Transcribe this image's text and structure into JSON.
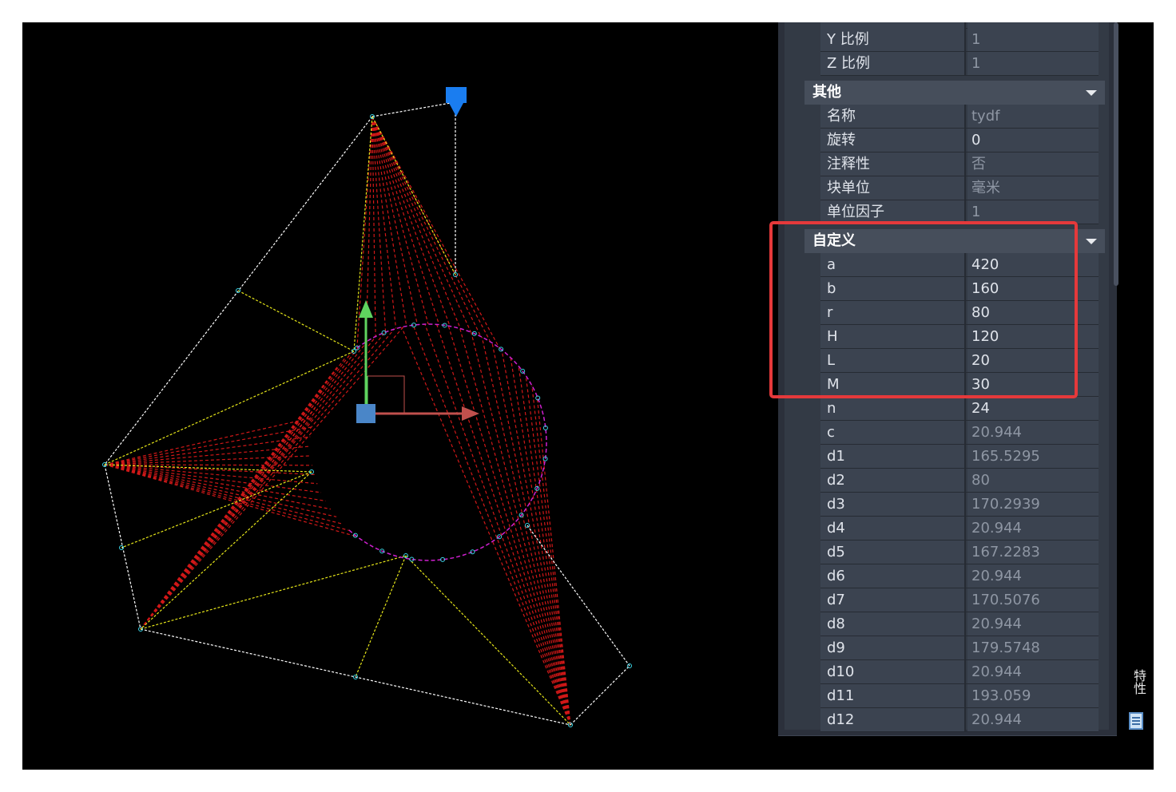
{
  "properties_panel": {
    "top_rows": [
      {
        "key": "Y 比例",
        "value": "1",
        "readonly": true
      },
      {
        "key": "Z 比例",
        "value": "1",
        "readonly": true
      }
    ],
    "section_other": {
      "title": "其他",
      "rows": [
        {
          "key": "名称",
          "value": "tydf",
          "readonly": true
        },
        {
          "key": "旋转",
          "value": "0",
          "readonly": false
        },
        {
          "key": "注释性",
          "value": "否",
          "readonly": true
        },
        {
          "key": "块单位",
          "value": "毫米",
          "readonly": true
        },
        {
          "key": "单位因子",
          "value": "1",
          "readonly": true
        }
      ]
    },
    "section_custom": {
      "title": "自定义",
      "editable_rows": [
        {
          "key": "a",
          "value": "420"
        },
        {
          "key": "b",
          "value": "160"
        },
        {
          "key": "r",
          "value": "80"
        },
        {
          "key": "H",
          "value": "120"
        },
        {
          "key": "L",
          "value": "20"
        },
        {
          "key": "M",
          "value": "30"
        },
        {
          "key": "n",
          "value": "24"
        }
      ],
      "computed_rows": [
        {
          "key": "c",
          "value": "20.944"
        },
        {
          "key": "d1",
          "value": "165.5295"
        },
        {
          "key": "d2",
          "value": "80"
        },
        {
          "key": "d3",
          "value": "170.2939"
        },
        {
          "key": "d4",
          "value": "20.944"
        },
        {
          "key": "d5",
          "value": "167.2283"
        },
        {
          "key": "d6",
          "value": "20.944"
        },
        {
          "key": "d7",
          "value": "170.5076"
        },
        {
          "key": "d8",
          "value": "20.944"
        },
        {
          "key": "d9",
          "value": "179.5748"
        },
        {
          "key": "d10",
          "value": "20.944"
        },
        {
          "key": "d11",
          "value": "193.059"
        },
        {
          "key": "d12",
          "value": "20.944"
        }
      ]
    }
  },
  "sidebar": {
    "tab_label": "特性",
    "icon": "properties-icon"
  },
  "colors": {
    "background": "#000000",
    "panel": "#333a45",
    "highlight": "#e5393b",
    "arc": "#d020d0",
    "fill_lines": "#d01818",
    "edge_yellow": "#e6e619",
    "edge_white": "#ffffff",
    "grip_blue": "#1a7df0",
    "ucs_x": "#c0504d",
    "ucs_y": "#5fd35f"
  }
}
